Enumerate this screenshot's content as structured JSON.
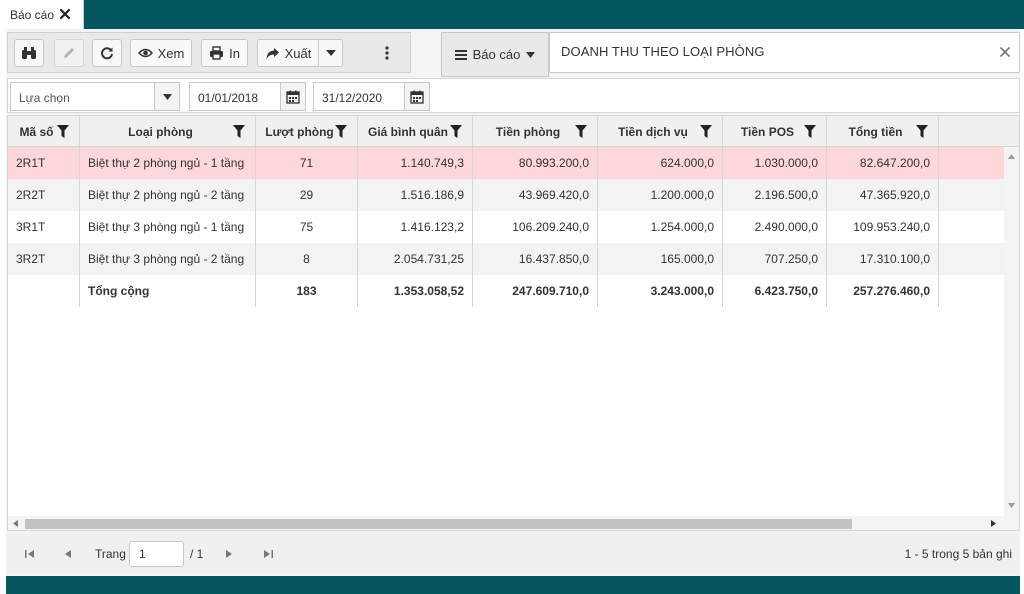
{
  "tab": {
    "label": "Báo cáo"
  },
  "toolbar": {
    "view_label": "Xem",
    "print_label": "In",
    "export_label": "Xuất"
  },
  "report_menu": {
    "label": "Báo cáo"
  },
  "report_title": "DOANH THU THEO LOẠI PHÒNG",
  "filters": {
    "option": "Lựa chọn",
    "date_from": "01/01/2018",
    "date_to": "31/12/2020"
  },
  "grid": {
    "columns": [
      "Mã số",
      "Loại phòng",
      "Lượt phòng",
      "Giá bình quân",
      "Tiền phòng",
      "Tiền dịch vụ",
      "Tiền POS",
      "Tổng tiền"
    ],
    "rows": [
      [
        "2R1T",
        "Biệt thự 2 phòng ngủ - 1 tầng",
        "71",
        "1.140.749,3",
        "80.993.200,0",
        "624.000,0",
        "1.030.000,0",
        "82.647.200,0"
      ],
      [
        "2R2T",
        "Biệt thự 2 phòng ngủ - 2 tầng",
        "29",
        "1.516.186,9",
        "43.969.420,0",
        "1.200.000,0",
        "2.196.500,0",
        "47.365.920,0"
      ],
      [
        "3R1T",
        "Biệt thự 3 phòng ngủ - 1 tầng",
        "75",
        "1.416.123,2",
        "106.209.240,0",
        "1.254.000,0",
        "2.490.000,0",
        "109.953.240,0"
      ],
      [
        "3R2T",
        "Biệt thự 3 phòng ngủ - 2 tầng",
        "8",
        "2.054.731,25",
        "16.437.850,0",
        "165.000,0",
        "707.250,0",
        "17.310.100,0"
      ]
    ],
    "total": [
      "",
      "Tổng cộng",
      "183",
      "1.353.058,52",
      "247.609.710,0",
      "3.243.000,0",
      "6.423.750,0",
      "257.276.460,0"
    ]
  },
  "pager": {
    "page_label": "Trang",
    "page_value": "1",
    "page_total": "/ 1",
    "info": "1 - 5 trong 5 bản ghi"
  },
  "colors": {
    "brand": "#04575f",
    "selected_row": "#fdd7d9"
  }
}
